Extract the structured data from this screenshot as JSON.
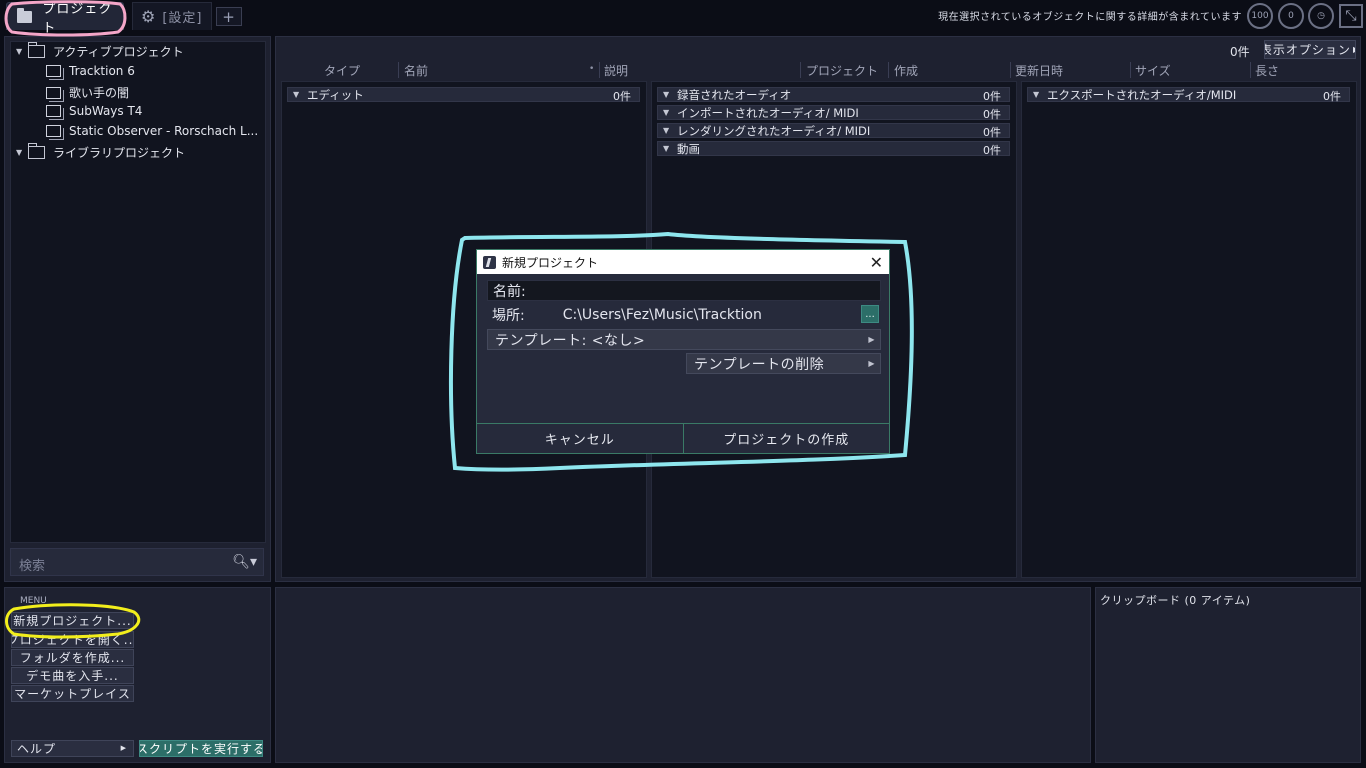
{
  "topbar": {
    "tab_projects": "プロジェクト",
    "tab_settings": "[設定]",
    "tab_add": "+",
    "status_text": "現在選択されているオブジェクトに関する詳細が含まれています",
    "dial_cpu": "100",
    "dial_disk": "0"
  },
  "tree": {
    "active_projects": "アクティブプロジェクト",
    "items": [
      "Tracktion 6",
      "歌い手の闇",
      "SubWays T4",
      "Static Observer - Rorschach L..."
    ],
    "library_projects": "ライブラリプロジェクト"
  },
  "search": {
    "placeholder": "検索"
  },
  "browser": {
    "count": "0件",
    "view_options": "表示オプション",
    "columns": [
      "タイプ",
      "名前",
      "説明",
      "プロジェクト",
      "作成",
      "更新日時",
      "サイズ",
      "長さ"
    ],
    "edit_group": {
      "label": "エディット",
      "count": "0件"
    },
    "media_groups": [
      {
        "label": "録音されたオーディオ",
        "count": "0件"
      },
      {
        "label": "インポートされたオーディオ/ MIDI",
        "count": "0件"
      },
      {
        "label": "レンダリングされたオーディオ/ MIDI",
        "count": "0件"
      },
      {
        "label": "動画",
        "count": "0件"
      }
    ],
    "export_group": {
      "label": "エクスポートされたオーディオ/MIDI",
      "count": "0件"
    }
  },
  "dialog": {
    "title": "新規プロジェクト",
    "name_label": "名前:",
    "location_label": "場所:",
    "location_value": "C:\\Users\\Fez\\Music\\Tracktion",
    "browse": "...",
    "template": "テンプレート: <なし>",
    "delete_template": "テンプレートの削除",
    "cancel": "キャンセル",
    "create": "プロジェクトの作成"
  },
  "menu": {
    "title": "MENU",
    "new_project": "新規プロジェクト...",
    "open_project": "プロジェクトを開く...",
    "create_folder": "フォルダを作成...",
    "get_demo": "デモ曲を入手...",
    "marketplace": "マーケットプレイス",
    "help": "ヘルプ",
    "run_script": "スクリプトを実行する"
  },
  "clipboard": {
    "title": "クリップボード (0 アイテム)"
  },
  "colors": {
    "accent": "#2c6e68",
    "dialog_border": "#3a7a66",
    "annot_pink": "#f4a6c8",
    "annot_cyan": "#8ee6ee",
    "annot_yellow": "#f2ee1c"
  }
}
